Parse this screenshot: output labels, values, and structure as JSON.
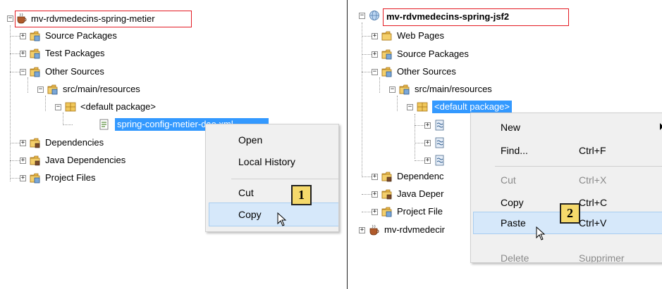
{
  "left_panel": {
    "project_name": "mv-rdvmedecins-spring-metier",
    "nodes": {
      "source_packages": "Source Packages",
      "test_packages": "Test Packages",
      "other_sources": "Other Sources",
      "resources": "src/main/resources",
      "default_package": "<default package>",
      "config_file": "spring-config-metier-dao.xml",
      "dependencies": "Dependencies",
      "java_dependencies": "Java Dependencies",
      "project_files": "Project Files"
    },
    "context_menu": {
      "items": [
        "Open",
        "Local History",
        "Cut",
        "Copy"
      ],
      "highlighted": "Copy"
    },
    "step_badge": "1"
  },
  "right_panel": {
    "project_name": "mv-rdvmedecins-spring-jsf2",
    "nodes": {
      "web_pages": "Web Pages",
      "source_packages": "Source Packages",
      "other_sources": "Other Sources",
      "resources": "src/main/resources",
      "default_package": "<default package>",
      "dependencies": "Dependenc",
      "java_dependencies": "Java Deper",
      "project_files": "Project File",
      "other_project": "mv-rdvmedecir"
    },
    "context_menu": {
      "items": [
        {
          "label": "New",
          "shortcut": ""
        },
        {
          "label": "Find...",
          "shortcut": "Ctrl+F"
        },
        {
          "label": "Cut",
          "shortcut": "Ctrl+X"
        },
        {
          "label": "Copy",
          "shortcut": "Ctrl+C"
        },
        {
          "label": "Paste",
          "shortcut": "Ctrl+V"
        },
        {
          "label": "Delete",
          "shortcut": "Supprimer"
        }
      ],
      "highlighted": "Paste"
    },
    "step_badge": "2"
  },
  "colors": {
    "selection": "#3399ff",
    "annotation_border": "#e31b23",
    "badge_fill": "#f5d96b",
    "menu_highlight": "#d6e8fa"
  }
}
